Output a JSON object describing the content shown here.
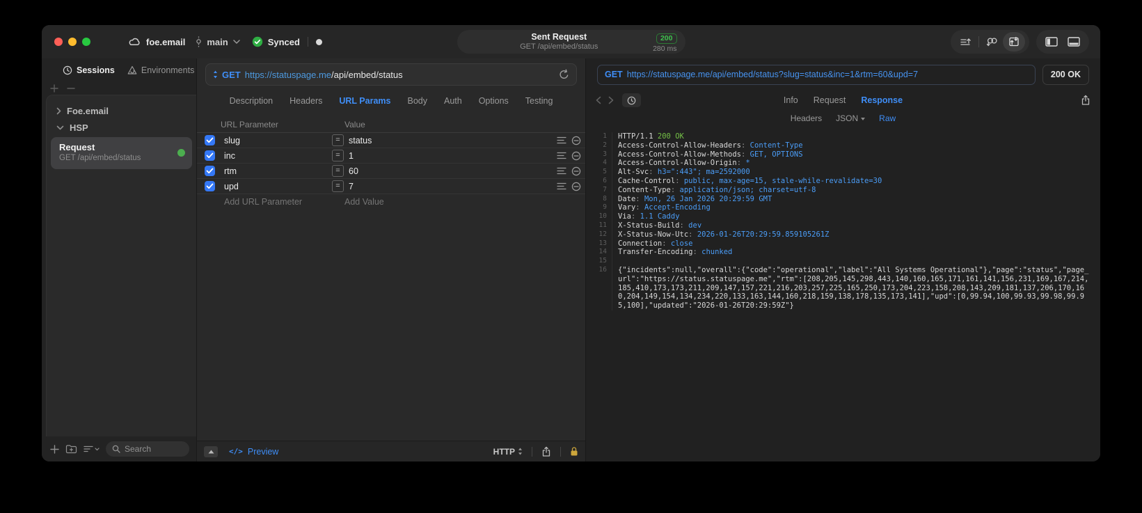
{
  "colors": {
    "accent_blue": "#3f8ef7",
    "status_green": "#3ec24d",
    "checkbox_blue": "#3478f6",
    "lock_gold": "#cda63b"
  },
  "titlebar": {
    "project": "foe.email",
    "branch": "main",
    "sync_status": "Synced",
    "sent": {
      "title": "Sent Request",
      "subtitle": "GET /api/embed/status",
      "code": "200",
      "time": "280 ms"
    }
  },
  "sidebar": {
    "tabs": [
      {
        "label": "Sessions"
      },
      {
        "label": "Environments"
      }
    ],
    "active_tab": "Sessions",
    "tree": [
      {
        "label": "Foe.email",
        "state": "collapsed"
      },
      {
        "label": "HSP",
        "state": "expanded"
      }
    ],
    "request": {
      "title": "Request",
      "subtitle": "GET /api/embed/status"
    },
    "search_label": "Search"
  },
  "request_editor": {
    "method": "GET",
    "url_host": "https://statuspage.me",
    "url_path": "/api/embed/status",
    "tabs": [
      "Description",
      "Headers",
      "URL Params",
      "Body",
      "Auth",
      "Options",
      "Testing"
    ],
    "active_tab": "URL Params",
    "table": {
      "col_param": "URL Parameter",
      "col_value": "Value",
      "rows": [
        {
          "enabled": true,
          "name": "slug",
          "value": "status"
        },
        {
          "enabled": true,
          "name": "inc",
          "value": "1"
        },
        {
          "enabled": true,
          "name": "rtm",
          "value": "60"
        },
        {
          "enabled": true,
          "name": "upd",
          "value": "7"
        }
      ],
      "add_param": "Add URL Parameter",
      "add_value": "Add Value"
    },
    "footer": {
      "code_glyph": "</>",
      "preview": "Preview",
      "protocol": "HTTP"
    }
  },
  "response_viewer": {
    "method": "GET",
    "url": "https://statuspage.me/api/embed/status?slug=status&inc=1&rtm=60&upd=7",
    "status": "200 OK",
    "tabs": [
      "Info",
      "Request",
      "Response"
    ],
    "active_tab": "Response",
    "subtabs": [
      "Headers",
      "JSON",
      "Raw"
    ],
    "active_subtab": "Raw",
    "dropdown_subtab": "JSON",
    "code_lines": [
      {
        "n": "1",
        "segs": [
          [
            "plain",
            "HTTP/1.1 "
          ],
          [
            "green",
            "200 OK"
          ]
        ]
      },
      {
        "n": "2",
        "segs": [
          [
            "plain",
            "Access-Control-Allow-Headers"
          ],
          [
            "dim",
            ": "
          ],
          [
            "blue",
            "Content-Type"
          ]
        ]
      },
      {
        "n": "3",
        "segs": [
          [
            "plain",
            "Access-Control-Allow-Methods"
          ],
          [
            "dim",
            ": "
          ],
          [
            "blue",
            "GET, OPTIONS"
          ]
        ]
      },
      {
        "n": "4",
        "segs": [
          [
            "plain",
            "Access-Control-Allow-Origin"
          ],
          [
            "dim",
            ": "
          ],
          [
            "blue",
            "*"
          ]
        ]
      },
      {
        "n": "5",
        "segs": [
          [
            "plain",
            "Alt-Svc"
          ],
          [
            "dim",
            ": "
          ],
          [
            "blue",
            "h3=\":443\"; ma=2592000"
          ]
        ]
      },
      {
        "n": "6",
        "segs": [
          [
            "plain",
            "Cache-Control"
          ],
          [
            "dim",
            ": "
          ],
          [
            "blue",
            "public, max-age=15, stale-while-revalidate=30"
          ]
        ]
      },
      {
        "n": "7",
        "segs": [
          [
            "plain",
            "Content-Type"
          ],
          [
            "dim",
            ": "
          ],
          [
            "blue",
            "application/json; charset=utf-8"
          ]
        ]
      },
      {
        "n": "8",
        "segs": [
          [
            "plain",
            "Date"
          ],
          [
            "dim",
            ": "
          ],
          [
            "blue",
            "Mon, 26 Jan 2026 20:29:59 GMT"
          ]
        ]
      },
      {
        "n": "9",
        "segs": [
          [
            "plain",
            "Vary"
          ],
          [
            "dim",
            ": "
          ],
          [
            "blue",
            "Accept-Encoding"
          ]
        ]
      },
      {
        "n": "10",
        "segs": [
          [
            "plain",
            "Via"
          ],
          [
            "dim",
            ": "
          ],
          [
            "blue",
            "1.1 Caddy"
          ]
        ]
      },
      {
        "n": "11",
        "segs": [
          [
            "plain",
            "X-Status-Build"
          ],
          [
            "dim",
            ": "
          ],
          [
            "blue",
            "dev"
          ]
        ]
      },
      {
        "n": "12",
        "segs": [
          [
            "plain",
            "X-Status-Now-Utc"
          ],
          [
            "dim",
            ": "
          ],
          [
            "blue",
            "2026-01-26T20:29:59.859105261Z"
          ]
        ]
      },
      {
        "n": "13",
        "segs": [
          [
            "plain",
            "Connection"
          ],
          [
            "dim",
            ": "
          ],
          [
            "blue",
            "close"
          ]
        ]
      },
      {
        "n": "14",
        "segs": [
          [
            "plain",
            "Transfer-Encoding"
          ],
          [
            "dim",
            ": "
          ],
          [
            "blue",
            "chunked"
          ]
        ]
      },
      {
        "n": "15",
        "segs": []
      },
      {
        "n": "16",
        "wrap": true,
        "segs": [
          [
            "plain",
            "{\"incidents\":null,\"overall\":{\"code\":\"operational\",\"label\":\"All Systems Operational\"},\"page\":\"status\",\"page_url\":\"https://status.statuspage.me\",\"rtm\":[208,205,145,298,443,140,160,165,171,161,141,156,231,169,167,214,185,410,173,173,211,209,147,157,221,216,203,257,225,165,250,173,204,223,158,208,143,209,181,137,206,170,160,204,149,154,134,234,220,133,163,144,160,218,159,138,178,135,173,141],\"upd\":[0,99.94,100,99.93,99.98,99.95,100],\"updated\":\"2026-01-26T20:29:59Z\"}"
          ]
        ]
      }
    ]
  }
}
